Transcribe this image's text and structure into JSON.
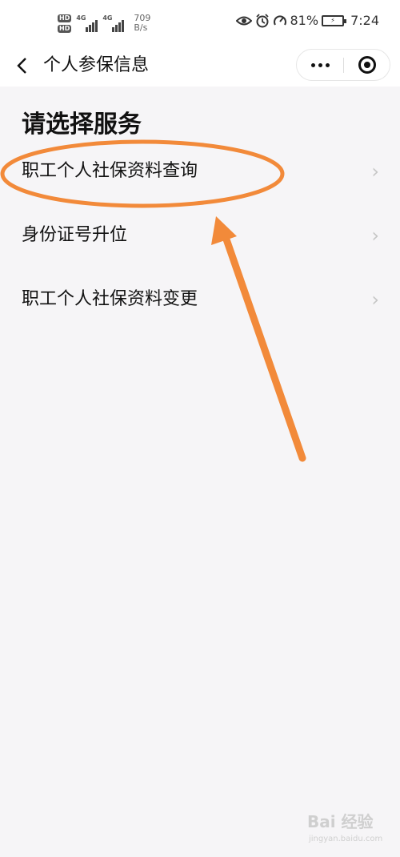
{
  "status_bar": {
    "hd_badges": [
      "HD",
      "HD"
    ],
    "network_labels": [
      "4G",
      "4G"
    ],
    "speed_value": "709",
    "speed_unit": "B/s",
    "battery": "81%",
    "time": "7:24",
    "icons": [
      "eye-icon",
      "alarm-icon",
      "gauge-icon",
      "battery-icon"
    ]
  },
  "navbar": {
    "back_glyph": "‹",
    "title": "个人参保信息",
    "more_icon": "more-dots-icon",
    "close_icon": "target-icon"
  },
  "content": {
    "section_title": "请选择服务",
    "items": [
      {
        "label": "职工个人社保资料查询",
        "chevron": "›"
      },
      {
        "label": "身份证号升位",
        "chevron": "›"
      },
      {
        "label": "职工个人社保资料变更",
        "chevron": "›"
      }
    ]
  },
  "annotation": {
    "color": "#f28a3a",
    "shapes": [
      "ellipse",
      "arrow"
    ]
  },
  "watermark": {
    "logo": "Bai 经验",
    "url": "jingyan.baidu.com"
  }
}
